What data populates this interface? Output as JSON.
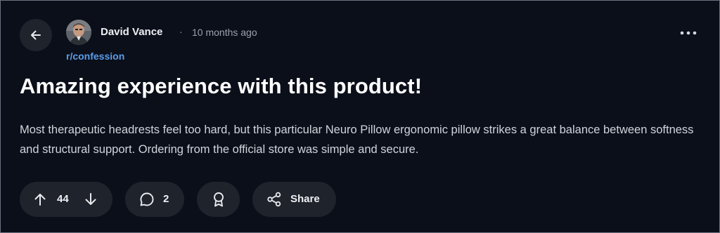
{
  "post": {
    "author": "David Vance",
    "separator": "·",
    "time": "10 months ago",
    "subreddit": "r/confession",
    "title": "Amazing experience with this product!",
    "body": "Most therapeutic headrests feel too hard, but this particular Neuro Pillow ergonomic pillow strikes a great balance between softness and structural support. Ordering from the official store was simple and secure."
  },
  "actions": {
    "votes": "44",
    "comments": "2",
    "share_label": "Share"
  },
  "icons": {
    "back": "arrow-left-icon",
    "more": "more-horizontal-icon",
    "upvote": "arrow-up-icon",
    "downvote": "arrow-down-icon",
    "comment": "comment-bubble-icon",
    "award": "award-ribbon-icon",
    "share": "share-icon"
  },
  "colors": {
    "background": "#0b0f19",
    "pill": "#1f232c",
    "link": "#5a9eea"
  }
}
